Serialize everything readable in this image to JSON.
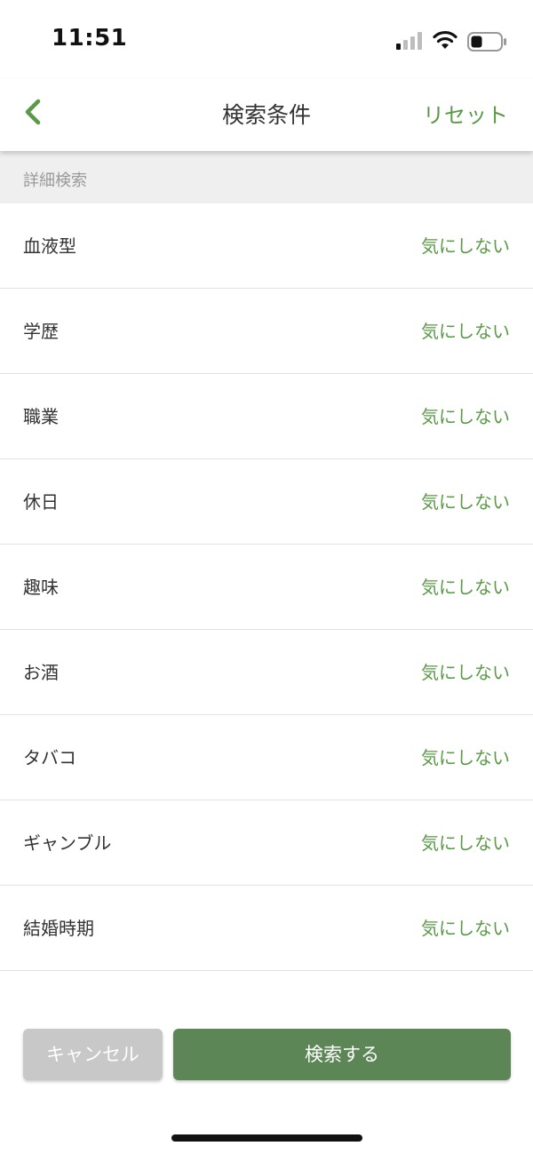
{
  "status_bar": {
    "time": "11:51",
    "icons": [
      "signal-icon",
      "wifi-icon",
      "battery-icon"
    ]
  },
  "nav": {
    "back_icon": "chevron-left-icon",
    "title": "検索条件",
    "reset_label": "リセット"
  },
  "section": {
    "title": "詳細検索"
  },
  "items": [
    {
      "label": "血液型",
      "value": "気にしない"
    },
    {
      "label": "学歴",
      "value": "気にしない"
    },
    {
      "label": "職業",
      "value": "気にしない"
    },
    {
      "label": "休日",
      "value": "気にしない"
    },
    {
      "label": "趣味",
      "value": "気にしない"
    },
    {
      "label": "お酒",
      "value": "気にしない"
    },
    {
      "label": "タバコ",
      "value": "気にしない"
    },
    {
      "label": "ギャンブル",
      "value": "気にしない"
    },
    {
      "label": "結婚時期",
      "value": "気にしない"
    }
  ],
  "bottom": {
    "cancel_label": "キャンセル",
    "search_label": "検索する"
  },
  "colors": {
    "accent": "#5a9a47",
    "primary_button": "#5c8655",
    "cancel_button": "#c8c8c8",
    "section_bg": "#efefef"
  }
}
